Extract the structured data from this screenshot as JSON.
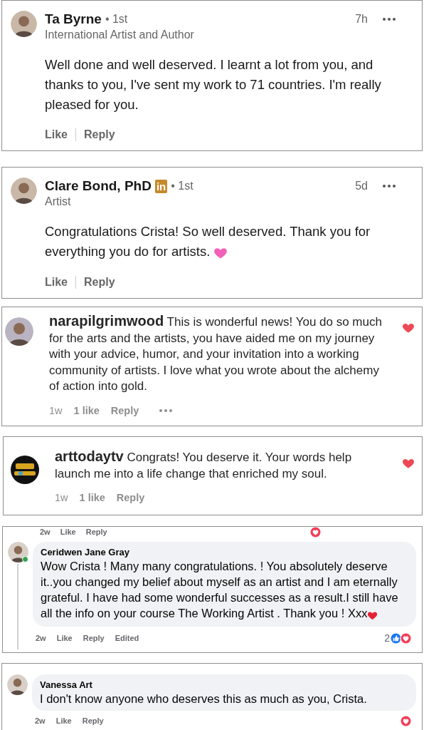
{
  "comments": [
    {
      "kind": "linkedin",
      "name": "Ta Byrne",
      "degree": "• 1st",
      "headline": "International Artist and Author",
      "time": "7h",
      "text": "Well done and well deserved. I learnt a lot from you, and thanks to you, I've sent my work to 71 countries. I'm really pleased for you.",
      "trailing_heart": false,
      "actions": [
        "Like",
        "Reply"
      ]
    },
    {
      "kind": "linkedin",
      "name": "Clare Bond, PhD",
      "badge": "in",
      "degree": "• 1st",
      "headline": "Artist",
      "time": "5d",
      "text": "Congratulations Crista! So well deserved. Thank you for everything you do for artists.",
      "trailing_heart": true,
      "actions": [
        "Like",
        "Reply"
      ]
    },
    {
      "kind": "instagram",
      "name": "narapilgrimwood",
      "text": "This is wonderful news! You do so much for the arts and the artists, you have aided me on my journey with your advice, humor, and your invitation into a working community of artists. I love what you wrote about the alchemy of action into gold.",
      "time": "1w",
      "likes": "1 like",
      "reply": "Reply",
      "more": true,
      "liked": true
    },
    {
      "kind": "instagram",
      "name": "arttodaytv",
      "avatar": {
        "kind": "logo"
      },
      "text": "Congrats! You deserve it. Your words help launch me into a life change that enriched my soul.",
      "time": "1w",
      "likes": "1 like",
      "reply": "Reply",
      "more": false,
      "liked": true
    },
    {
      "kind": "facebook",
      "top_actions": [
        "2w",
        "Like",
        "Reply"
      ],
      "top_reacted": true,
      "name": "Ceridwen Jane Gray",
      "online": true,
      "thread": true,
      "text": "Wow Crista ! Many many congratulations. ! You absolutely deserve it..you changed my belief about myself as an artist and I am eternally grateful. I have had some wonderful successes as a result.I still have all the info on your course The Working Artist . Thank you ! Xxx",
      "trailing_heart": true,
      "actions": [
        "2w",
        "Like",
        "Reply",
        "Edited"
      ],
      "reaction_count": "2",
      "reactions": [
        {
          "kind": "like"
        },
        {
          "kind": "love"
        }
      ]
    },
    {
      "kind": "facebook",
      "name": "Vanessa Art",
      "online": false,
      "thread": false,
      "text": "I don't know anyone who deserves this as much as you, Crista.",
      "trailing_heart": false,
      "actions": [
        "2w",
        "Like",
        "Reply"
      ],
      "reactions": [
        {
          "kind": "love"
        }
      ]
    }
  ]
}
